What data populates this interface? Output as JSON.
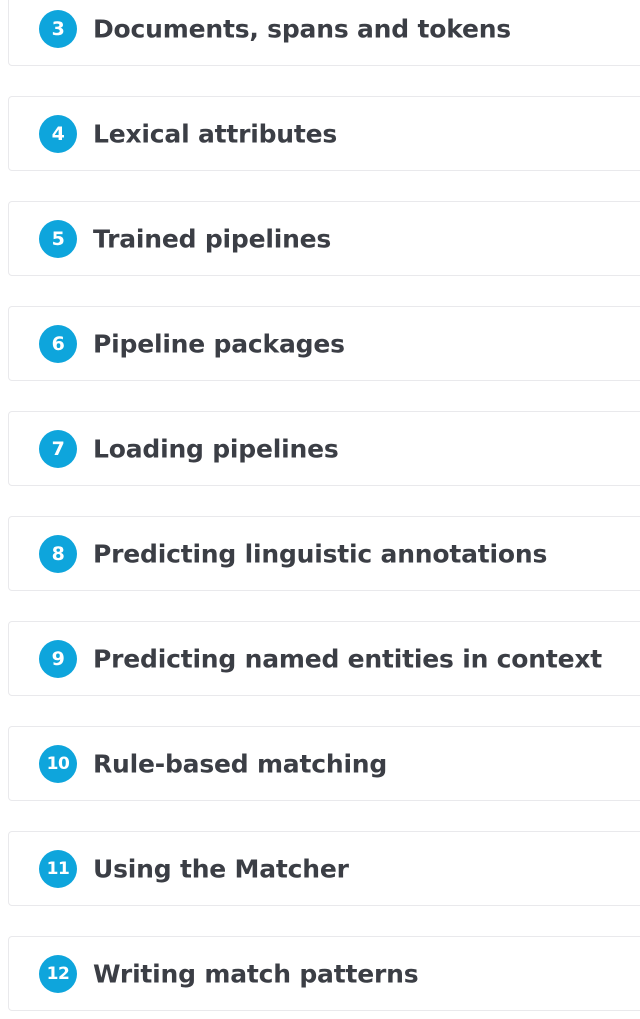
{
  "chapters": [
    {
      "number": "3",
      "title": "Documents, spans and tokens"
    },
    {
      "number": "4",
      "title": "Lexical attributes"
    },
    {
      "number": "5",
      "title": "Trained pipelines"
    },
    {
      "number": "6",
      "title": "Pipeline packages"
    },
    {
      "number": "7",
      "title": "Loading pipelines"
    },
    {
      "number": "8",
      "title": "Predicting linguistic annotations"
    },
    {
      "number": "9",
      "title": "Predicting named entities in context"
    },
    {
      "number": "10",
      "title": "Rule-based matching"
    },
    {
      "number": "11",
      "title": "Using the Matcher"
    },
    {
      "number": "12",
      "title": "Writing match patterns"
    }
  ],
  "colors": {
    "accent": "#0ea5dc",
    "title_text": "#3b3e45",
    "card_border": "#e9e9ec"
  }
}
